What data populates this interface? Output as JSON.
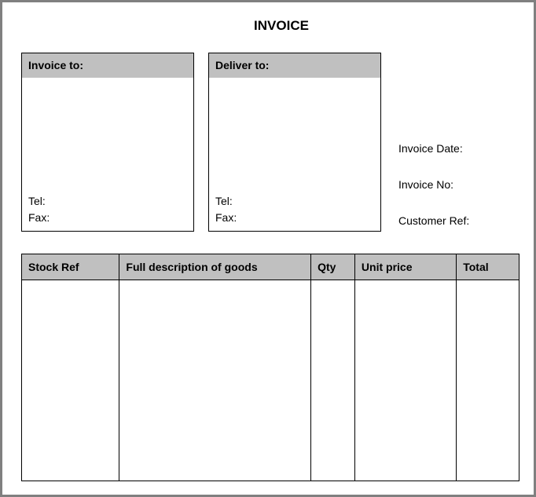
{
  "title": "INVOICE",
  "invoice_to": {
    "header": "Invoice to:",
    "tel_label": "Tel:",
    "fax_label": "Fax:"
  },
  "deliver_to": {
    "header": "Deliver to:",
    "tel_label": "Tel:",
    "fax_label": "Fax:"
  },
  "meta": {
    "invoice_date_label": "Invoice Date:",
    "invoice_no_label": "Invoice No:",
    "customer_ref_label": "Customer Ref:"
  },
  "table": {
    "headers": {
      "stock_ref": "Stock Ref",
      "description": "Full description of goods",
      "qty": "Qty",
      "unit_price": "Unit price",
      "total": "Total"
    }
  }
}
